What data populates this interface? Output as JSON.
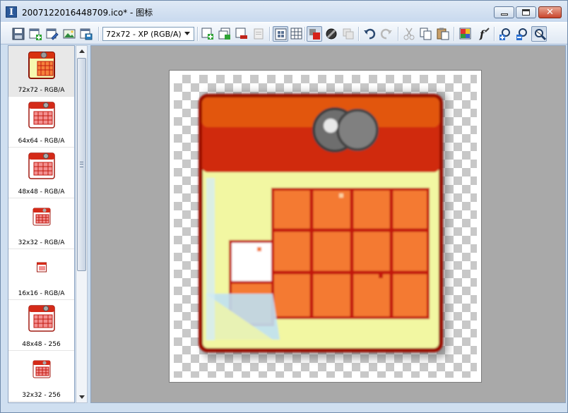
{
  "window": {
    "title": "2007122016448709.ico* - 图标",
    "app_icon_letter": "I",
    "close_glyph": "✕"
  },
  "toolbar": {
    "format_combo": "72x72 - XP (RGB/A)",
    "buttons": [
      "save",
      "new-image",
      "edit-format",
      "import-image",
      "export-image",
      "add-format",
      "copy-format",
      "delete-format",
      "format-properties",
      "view-large",
      "view-grid",
      "view-color",
      "view-mask",
      "view-layers",
      "undo",
      "redo",
      "cut",
      "copy",
      "paste",
      "palette",
      "effects",
      "zoom-in",
      "zoom-out",
      "zoom-fit"
    ]
  },
  "sidebar": {
    "items": [
      {
        "label": "72x72 - RGB/A",
        "selected": true
      },
      {
        "label": "64x64 - RGB/A"
      },
      {
        "label": "48x48 - RGB/A"
      },
      {
        "label": "32x32 - RGB/A"
      },
      {
        "label": "16x16 - RGB/A"
      },
      {
        "label": "48x48 - 256"
      },
      {
        "label": "32x32 - 256"
      }
    ]
  },
  "colors": {
    "accent": "#2c5a9a",
    "calendar_red": "#c81a0c",
    "calendar_orange": "#f07832",
    "calendar_yellow": "#f4f8a8"
  }
}
